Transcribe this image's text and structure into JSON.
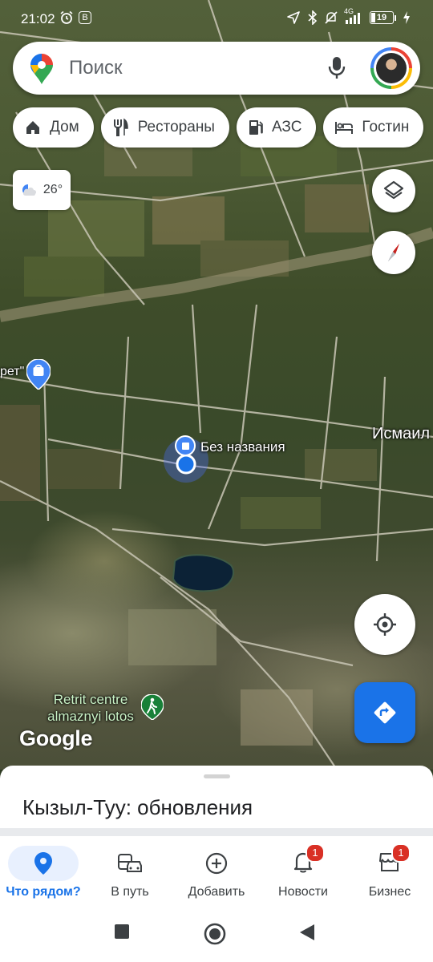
{
  "status_bar": {
    "time": "21:02",
    "b_icon_label": "B",
    "battery_level": "19",
    "network": "4G"
  },
  "search": {
    "placeholder": "Поиск"
  },
  "chips": [
    {
      "label": "Дом",
      "icon": "home-icon"
    },
    {
      "label": "Рестораны",
      "icon": "restaurant-icon"
    },
    {
      "label": "АЗС",
      "icon": "gas-station-icon"
    },
    {
      "label": "Гостин",
      "icon": "hotel-icon"
    }
  ],
  "weather": {
    "temp": "26°"
  },
  "map": {
    "selected_place": "Без названия",
    "town_label": "Исмаил",
    "partial_label": "рет\"",
    "poi_label": "Retrit centre almaznyi lotos",
    "attribution": "Google"
  },
  "sheet": {
    "title": "Кызыл-Туу: обновления"
  },
  "nav": {
    "items": [
      {
        "label": "Что рядом?",
        "icon": "location-pin-icon",
        "badge": ""
      },
      {
        "label": "В путь",
        "icon": "commute-icon",
        "badge": ""
      },
      {
        "label": "Добавить",
        "icon": "add-circle-icon",
        "badge": ""
      },
      {
        "label": "Новости",
        "icon": "bell-icon",
        "badge": "1"
      },
      {
        "label": "Бизнес",
        "icon": "store-icon",
        "badge": "1"
      }
    ]
  },
  "colors": {
    "accent": "#1a73e8",
    "badge": "#d93025",
    "poi_label": "#c9f2c6"
  }
}
